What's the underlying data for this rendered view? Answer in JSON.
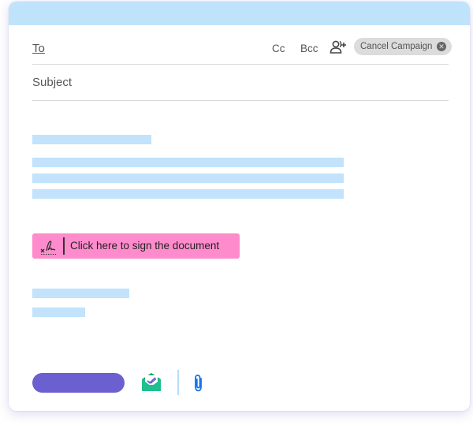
{
  "compose": {
    "to_label": "To",
    "cc_label": "Cc",
    "bcc_label": "Bcc",
    "add_recipient_icon": "add-person-icon",
    "campaign_chip": {
      "label": "Cancel Campaign",
      "close_icon": "close-circle-icon"
    },
    "subject_placeholder": "Subject"
  },
  "body": {
    "sign_button": {
      "label": "Click here to sign the document",
      "icon": "signature-icon"
    }
  },
  "footer": {
    "send_icon": "",
    "envelope_icon": "envelope-check-icon",
    "attach_icon": "paperclip-icon"
  },
  "colors": {
    "titlebar": "#bfe3fb",
    "placeholder_bar": "#c2e3fb",
    "sign_button": "#fe8ccd",
    "send_button": "#6c5fcf",
    "envelope_green": "#1fbf8f"
  }
}
